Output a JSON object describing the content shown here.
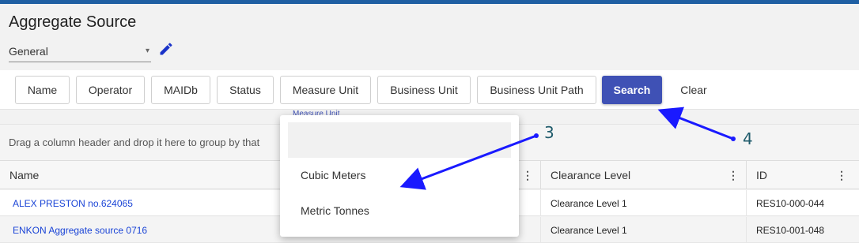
{
  "page": {
    "title": "Aggregate Source"
  },
  "view_select": {
    "value": "General",
    "caret": "▾"
  },
  "filters": {
    "buttons": [
      {
        "label": "Name"
      },
      {
        "label": "Operator"
      },
      {
        "label": "MAIDb"
      },
      {
        "label": "Status"
      },
      {
        "label": "Measure Unit"
      },
      {
        "label": "Business Unit"
      },
      {
        "label": "Business Unit Path"
      }
    ],
    "search_label": "Search",
    "clear_label": "Clear"
  },
  "group_hint": "Drag a column header and drop it here to group by that",
  "grid": {
    "columns": [
      {
        "label": "Name"
      },
      {
        "label": "Clearance Level"
      },
      {
        "label": "ID"
      }
    ],
    "menu_glyph": "⋮",
    "rows": [
      {
        "name": "ALEX PRESTON no.624065",
        "clearance": "Clearance Level 1",
        "id": "RES10-000-044"
      },
      {
        "name": "ENKON Aggregate source 0716",
        "clearance": "Clearance Level 1",
        "id": "RES10-001-048"
      }
    ]
  },
  "measure_unit_dropdown": {
    "label": "Measure Unit",
    "options": [
      "Cubic Meters",
      "Metric Tonnes"
    ]
  },
  "annotations": {
    "three": "3",
    "four": "4"
  },
  "colors": {
    "accent": "#3f51b5",
    "arrow": "#1a1aff",
    "link": "#1a44d6",
    "topbar": "#1f5fa3"
  },
  "icons": {
    "edit": "pencil-icon",
    "caret": "chevron-down-icon",
    "column_menu": "kebab-menu-icon"
  }
}
